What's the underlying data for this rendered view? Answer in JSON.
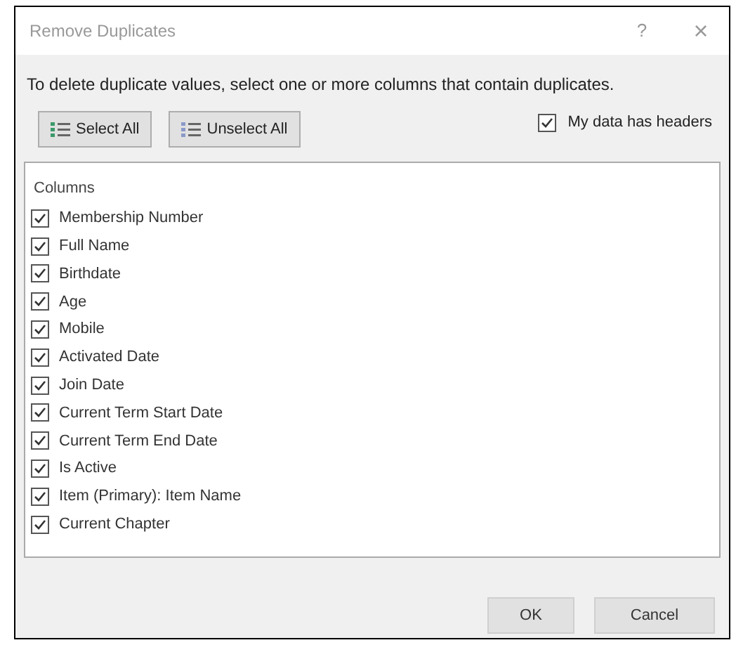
{
  "window": {
    "title": "Remove Duplicates",
    "help": "?",
    "close": "×"
  },
  "instruction": "To delete duplicate values, select one or more columns that contain duplicates.",
  "toolbar": {
    "select_all": "Select All",
    "unselect_all": "Unselect All",
    "headers": {
      "label": "My data has headers",
      "checked": true
    }
  },
  "columns_header": "Columns",
  "columns": [
    {
      "label": "Membership Number",
      "checked": true
    },
    {
      "label": "Full Name",
      "checked": true
    },
    {
      "label": "Birthdate",
      "checked": true
    },
    {
      "label": "Age",
      "checked": true
    },
    {
      "label": "Mobile",
      "checked": true
    },
    {
      "label": "Activated Date",
      "checked": true
    },
    {
      "label": "Join Date",
      "checked": true
    },
    {
      "label": "Current Term Start Date",
      "checked": true
    },
    {
      "label": "Current Term End Date",
      "checked": true
    },
    {
      "label": "Is Active",
      "checked": true
    },
    {
      "label": "Item (Primary): Item Name",
      "checked": true
    },
    {
      "label": "Current Chapter",
      "checked": true
    }
  ],
  "buttons": [
    "OK",
    "Cancel"
  ]
}
